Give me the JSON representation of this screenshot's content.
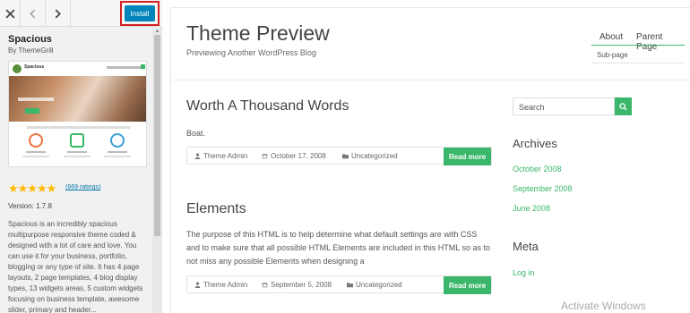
{
  "sidebar": {
    "install_label": "Install",
    "theme_name": "Spacious",
    "theme_author": "By ThemeGrill",
    "screenshot": {
      "site_title": "Spacious"
    },
    "stars": "★★★★★",
    "rating": 5,
    "ratings_link": "(669 ratings)",
    "version": "Version: 1.7.8",
    "description": "Spacious is an incredibly spacious multipurpose responsive theme coded & designed with a lot of care and love. You can use it for your business, portfolio, blogging or any type of site. It has 4 page layouts, 2 page templates, 4 blog display types, 13 widgets areas, 5 custom widgets focusing on business template, awesome slider, primary and header...",
    "icons": [
      "close-icon",
      "chevron-left-icon",
      "chevron-right-icon"
    ]
  },
  "preview": {
    "site_title": "Theme Preview",
    "tagline": "Previewing Another WordPress Blog",
    "nav": {
      "about": "About",
      "parent_page": "Parent Page",
      "sub_page": "Sub-page"
    },
    "posts": [
      {
        "title": "Worth A Thousand Words",
        "excerpt": "Boat.",
        "author": "Theme Admin",
        "date": "October 17, 2008",
        "category": "Uncategorized",
        "read_more": "Read more"
      },
      {
        "title": "Elements",
        "excerpt": "The purpose of this HTML is to help determine what default settings are with CSS and to make sure that all possible HTML Elements are included in this HTML so as to not miss any possible Elements when designing a",
        "author": "Theme Admin",
        "date": "September 5, 2008",
        "category": "Uncategorized",
        "read_more": "Read more"
      }
    ],
    "search": {
      "placeholder": "Search"
    },
    "archives": {
      "title": "Archives",
      "links": [
        "October 2008",
        "September 2008",
        "June 2008"
      ]
    },
    "meta": {
      "title": "Meta",
      "links": [
        "Log in"
      ]
    },
    "accent_color": "#3ab76a"
  },
  "watermark": "Activate Windows"
}
